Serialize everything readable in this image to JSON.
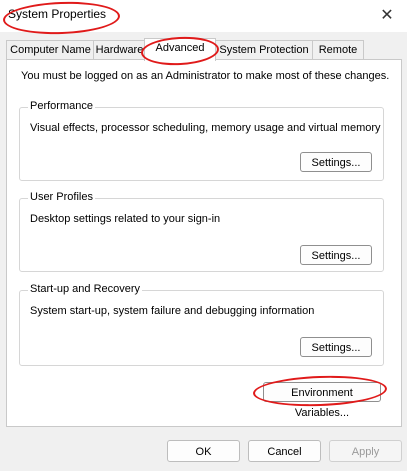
{
  "window": {
    "title": "System Properties"
  },
  "tabs": [
    {
      "label": "Computer Name",
      "active": false
    },
    {
      "label": "Hardware",
      "active": false
    },
    {
      "label": "Advanced",
      "active": true
    },
    {
      "label": "System Protection",
      "active": false
    },
    {
      "label": "Remote",
      "active": false
    }
  ],
  "advanced": {
    "admin_note": "You must be logged on as an Administrator to make most of these changes.",
    "performance": {
      "title": "Performance",
      "description": "Visual effects, processor scheduling, memory usage and virtual memory",
      "button": "Settings..."
    },
    "user_profiles": {
      "title": "User Profiles",
      "description": "Desktop settings related to your sign-in",
      "button": "Settings..."
    },
    "startup_recovery": {
      "title": "Start-up and Recovery",
      "description": "System start-up, system failure and debugging information",
      "button": "Settings..."
    },
    "env_button": "Environment Variables..."
  },
  "footer": {
    "ok": "OK",
    "cancel": "Cancel",
    "apply": "Apply"
  },
  "colors": {
    "annotation": "#e01a1a",
    "window_bg": "#f0f0f0",
    "panel_bg": "#ffffff"
  }
}
